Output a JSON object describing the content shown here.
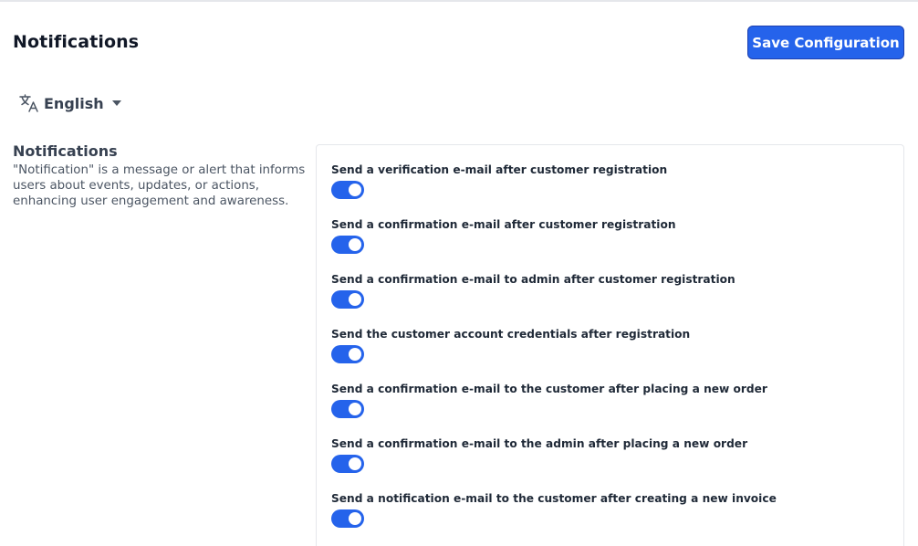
{
  "header": {
    "title": "Notifications",
    "save_label": "Save Configuration"
  },
  "locale": {
    "label": "English",
    "icon": "translate-icon"
  },
  "section": {
    "title": "Notifications",
    "description": "\"Notification\" is a message or alert that informs users about events, updates, or actions, enhancing user engagement and awareness."
  },
  "settings": [
    {
      "label": "Send a verification e-mail after customer registration",
      "enabled": true
    },
    {
      "label": "Send a confirmation e-mail after customer registration",
      "enabled": true
    },
    {
      "label": "Send a confirmation e-mail to admin after customer registration",
      "enabled": true
    },
    {
      "label": "Send the customer account credentials after registration",
      "enabled": true
    },
    {
      "label": "Send a confirmation e-mail to the customer after placing a new order",
      "enabled": true
    },
    {
      "label": "Send a confirmation e-mail to the admin after placing a new order",
      "enabled": true
    },
    {
      "label": "Send a notification e-mail to the customer after creating a new invoice",
      "enabled": true
    }
  ],
  "colors": {
    "accent": "#2563eb",
    "toggle_on": "#2563eb"
  }
}
